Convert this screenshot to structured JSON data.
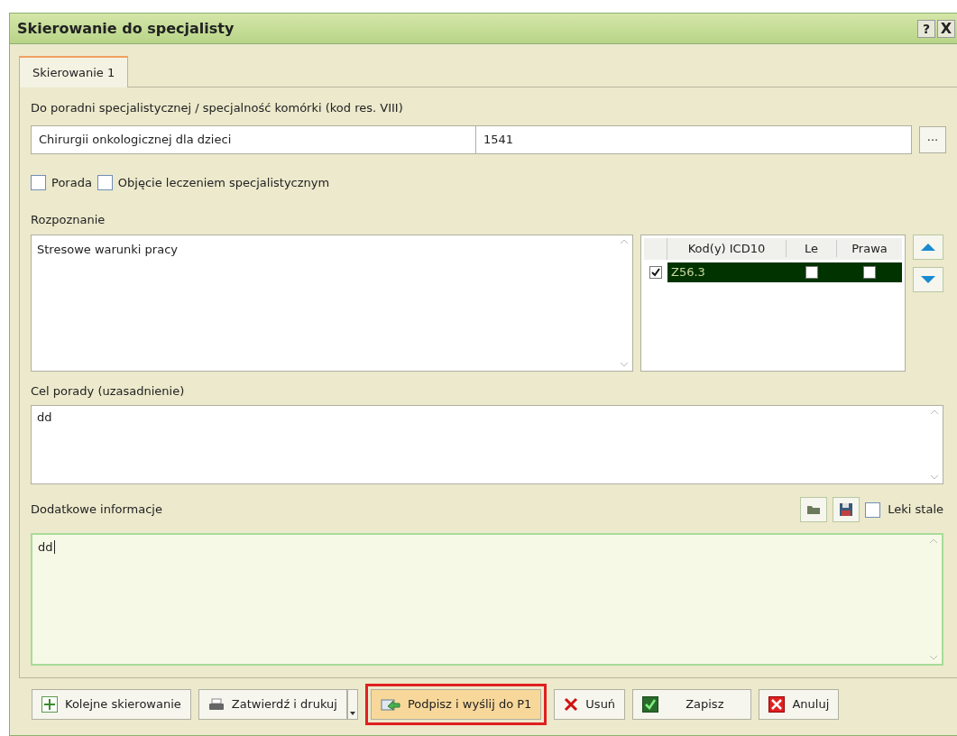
{
  "window": {
    "title": "Skierowanie do specjalisty",
    "help": "?",
    "close": "X"
  },
  "tabs": [
    {
      "label": "Skierowanie 1",
      "selected": true
    }
  ],
  "clinic": {
    "label": "Do poradni specjalistycznej / specjalność komórki (kod res. VIII)",
    "name": "Chirurgii onkologicznej dla dzieci",
    "code": "1541",
    "browse": "..."
  },
  "options": [
    {
      "label": "Porada",
      "checked": false
    },
    {
      "label": "Objęcie leczeniem specjalistycznym",
      "checked": false
    }
  ],
  "diagnosis": {
    "label": "Rozpoznanie",
    "text": "Stresowe warunki pracy",
    "icd_table": {
      "columns": [
        "Kod(y) ICD10",
        "Le",
        "Prawa"
      ],
      "rows": [
        {
          "checked": true,
          "code": "Z56.3",
          "left": false,
          "right": false,
          "selected": true
        }
      ]
    }
  },
  "purpose": {
    "label": "Cel porady (uzasadnienie)",
    "text": "dd"
  },
  "additional": {
    "label": "Dodatkowe informacje",
    "text": "dd",
    "permanent_drugs": {
      "label": "Leki stale",
      "checked": false
    }
  },
  "buttons": [
    {
      "kind": "plus",
      "label": "Kolejne skierowanie",
      "highlighted": false
    },
    {
      "kind": "print",
      "label": "Zatwierdź i drukuj",
      "highlighted": false
    },
    {
      "kind": "send",
      "label": "Podpisz i wyślij do P1",
      "highlighted": true
    },
    {
      "kind": "delete",
      "label": "Usuń",
      "highlighted": false
    },
    {
      "kind": "save",
      "label": "Zapisz",
      "highlighted": false
    },
    {
      "kind": "cancel",
      "label": "Anuluj",
      "highlighted": false
    }
  ]
}
